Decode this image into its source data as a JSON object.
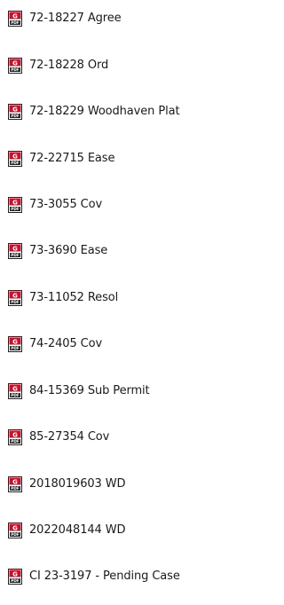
{
  "files": [
    {
      "name": "72-18227 Agree",
      "icon": "pdf-file-icon"
    },
    {
      "name": "72-18228 Ord",
      "icon": "pdf-file-icon"
    },
    {
      "name": "72-18229 Woodhaven Plat",
      "icon": "pdf-file-icon"
    },
    {
      "name": "72-22715 Ease",
      "icon": "pdf-file-icon"
    },
    {
      "name": "73-3055 Cov",
      "icon": "pdf-file-icon"
    },
    {
      "name": "73-3690 Ease",
      "icon": "pdf-file-icon"
    },
    {
      "name": "73-11052 Resol",
      "icon": "pdf-file-icon"
    },
    {
      "name": "74-2405 Cov",
      "icon": "pdf-file-icon"
    },
    {
      "name": "84-15369 Sub Permit",
      "icon": "pdf-file-icon"
    },
    {
      "name": "85-27354 Cov",
      "icon": "pdf-file-icon"
    },
    {
      "name": "2018019603 WD",
      "icon": "pdf-file-icon"
    },
    {
      "name": "2022048144 WD",
      "icon": "pdf-file-icon"
    },
    {
      "name": "CI 23-3197 - Pending Case",
      "icon": "pdf-file-icon"
    }
  ],
  "colors": {
    "text": "#1a1a1a",
    "icon_red": "#c8102e",
    "icon_dark": "#222222"
  }
}
